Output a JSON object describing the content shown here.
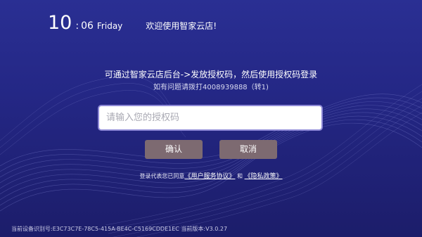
{
  "colors": {
    "background_top": "#2a2f93",
    "background_bottom": "#1c1d6a",
    "button_fill": "#7d6a71",
    "input_border": "#8d88d6"
  },
  "status_bar": {
    "hour": "10",
    "separator": ":",
    "minute": "06",
    "weekday": "Friday",
    "welcome": "欢迎使用智家云店!"
  },
  "auth": {
    "instruction": "可通过智家云店后台->发放授权码，然后使用授权码登录",
    "hotline": "如有问题请拨打4008939888（转1)",
    "input_value": "",
    "input_placeholder": "请输入您的授权码",
    "confirm_label": "确认",
    "cancel_label": "取消"
  },
  "agreement": {
    "prefix": "登录代表您已同意",
    "user_agreement": "《用户服务协议》",
    "conjunction": "和",
    "privacy_policy": "《隐私政策》"
  },
  "footer": {
    "device_info": "当前设备识别号:E3C73C7E-78C5-415A-BE4C-C5169CDDE1EC 当前版本:V3.0.27"
  }
}
